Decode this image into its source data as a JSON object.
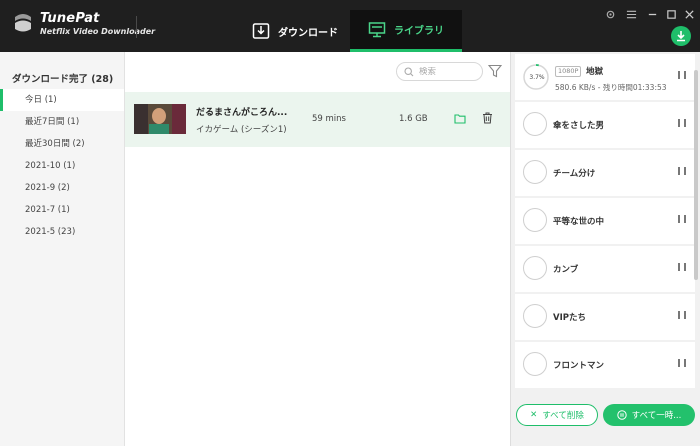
{
  "app": {
    "name": "TunePat",
    "subtitle": "Netflix Video Downloader",
    "accent": "#1fbe6a"
  },
  "tabs": [
    {
      "label": "ダウンロード",
      "icon": "download-tray-icon",
      "active": false
    },
    {
      "label": "ライブラリ",
      "icon": "monitor-icon",
      "active": true
    }
  ],
  "window_controls": [
    "gear-icon",
    "menu-icon",
    "minimize-icon",
    "maximize-icon",
    "close-icon"
  ],
  "sidebar": {
    "header": "ダウンロード完了 (28)",
    "items": [
      {
        "label": "今日 (1)",
        "active": true
      },
      {
        "label": "最近7日間 (1)",
        "active": false
      },
      {
        "label": "最近30日間 (2)",
        "active": false
      },
      {
        "label": "2021-10 (1)",
        "active": false
      },
      {
        "label": "2021-9 (2)",
        "active": false
      },
      {
        "label": "2021-7 (1)",
        "active": false
      },
      {
        "label": "2021-5 (23)",
        "active": false
      }
    ]
  },
  "search": {
    "placeholder": "検索"
  },
  "library": {
    "rows": [
      {
        "title": "だるまさんがころん...",
        "subtitle": "イカゲーム (シーズン1)",
        "duration": "59 mins",
        "size": "1.6 GB"
      }
    ]
  },
  "queue": {
    "active": {
      "percent": "3.7%",
      "progress": 0.037,
      "quality": "1080P",
      "title": "地獄",
      "speed": "580.6 KB/s - 残り時間01:33:53"
    },
    "items": [
      {
        "title": "傘をさした男"
      },
      {
        "title": "チーム分け"
      },
      {
        "title": "平等な世の中"
      },
      {
        "title": "カンブ"
      },
      {
        "title": "VIPたち"
      },
      {
        "title": "フロントマン"
      }
    ]
  },
  "buttons": {
    "delete_all": "すべて削除",
    "pause_all": "すべて一時..."
  }
}
